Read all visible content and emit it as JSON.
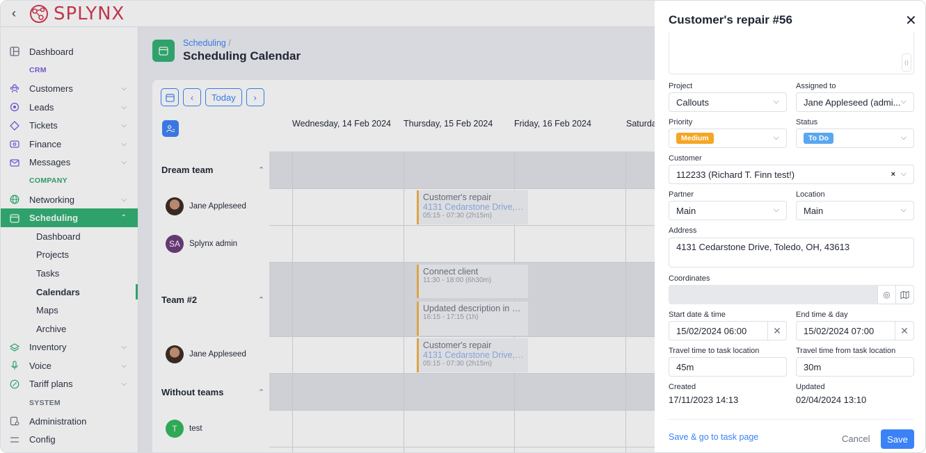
{
  "app": {
    "logo_text": "SPLYNX"
  },
  "sidebar": {
    "items": [
      {
        "label": "Dashboard"
      },
      {
        "section": "CRM"
      },
      {
        "label": "Customers"
      },
      {
        "label": "Leads"
      },
      {
        "label": "Tickets"
      },
      {
        "label": "Finance"
      },
      {
        "label": "Messages"
      },
      {
        "section": "COMPANY"
      },
      {
        "label": "Networking"
      },
      {
        "label": "Scheduling"
      },
      {
        "label": "Dashboard"
      },
      {
        "label": "Projects"
      },
      {
        "label": "Tasks"
      },
      {
        "label": "Calendars"
      },
      {
        "label": "Maps"
      },
      {
        "label": "Archive"
      },
      {
        "label": "Inventory"
      },
      {
        "label": "Voice"
      },
      {
        "label": "Tariff plans"
      },
      {
        "section": "SYSTEM"
      },
      {
        "label": "Administration"
      },
      {
        "label": "Config"
      }
    ]
  },
  "page": {
    "breadcrumb": "Scheduling",
    "breadcrumb_sep": "/",
    "title": "Scheduling Calendar"
  },
  "calendar": {
    "today_label": "Today",
    "days": [
      "Wednesday, 14 Feb 2024",
      "Thursday, 15 Feb 2024",
      "Friday, 16 Feb 2024",
      "Saturda"
    ],
    "teams": [
      {
        "name": "Dream team",
        "members": [
          "Jane Appleseed",
          "Splynx admin"
        ]
      },
      {
        "name": "Team #2",
        "members": [
          "Jane Appleseed"
        ]
      },
      {
        "name": "Without teams",
        "members": [
          "test"
        ]
      }
    ],
    "avatar_initials": {
      "splynx_admin": "SA",
      "test": "T"
    },
    "events": [
      {
        "title": "Customer's repair",
        "address": "4131 Cedarstone Drive, T...",
        "time": "05:15 - 07:30 (2h15m)"
      },
      {
        "title": "Connect client",
        "time": "11:30 - 18:00 (6h30m)"
      },
      {
        "title": "Updated description in pl...",
        "time": "16:15 - 17:15 (1h)"
      },
      {
        "title": "Customer's repair",
        "address": "4131 Cedarstone Drive, T...",
        "time": "05:15 - 07:30 (2h15m)"
      }
    ],
    "event_color": "#f0b34a"
  },
  "panel": {
    "title": "Customer's repair #56",
    "project": {
      "label": "Project",
      "value": "Callouts"
    },
    "assigned": {
      "label": "Assigned to",
      "value": "Jane Appleseed (admi..."
    },
    "priority": {
      "label": "Priority",
      "value": "Medium",
      "color": "#f5a623"
    },
    "status": {
      "label": "Status",
      "value": "To Do",
      "color": "#5aa7f0"
    },
    "customer": {
      "label": "Customer",
      "value": "112233 (Richard T. Finn test!)"
    },
    "partner": {
      "label": "Partner",
      "value": "Main"
    },
    "location": {
      "label": "Location",
      "value": "Main"
    },
    "address": {
      "label": "Address",
      "value": "4131 Cedarstone Drive, Toledo, OH, 43613"
    },
    "coordinates": {
      "label": "Coordinates",
      "value": ""
    },
    "start": {
      "label": "Start date & time",
      "value": "15/02/2024 06:00"
    },
    "end": {
      "label": "End time & day",
      "value": "15/02/2024 07:00"
    },
    "travel_to": {
      "label": "Travel time to task location",
      "value": "45m"
    },
    "travel_from": {
      "label": "Travel time from task location",
      "value": "30m"
    },
    "created": {
      "label": "Created",
      "value": "17/11/2023 14:13"
    },
    "updated": {
      "label": "Updated",
      "value": "02/04/2024 13:10"
    },
    "save_go_label": "Save & go to task page",
    "cancel_label": "Cancel",
    "save_label": "Save"
  },
  "colors": {
    "accent": "#2fb071",
    "primary": "#3b82f6",
    "brand": "#d1384f"
  }
}
